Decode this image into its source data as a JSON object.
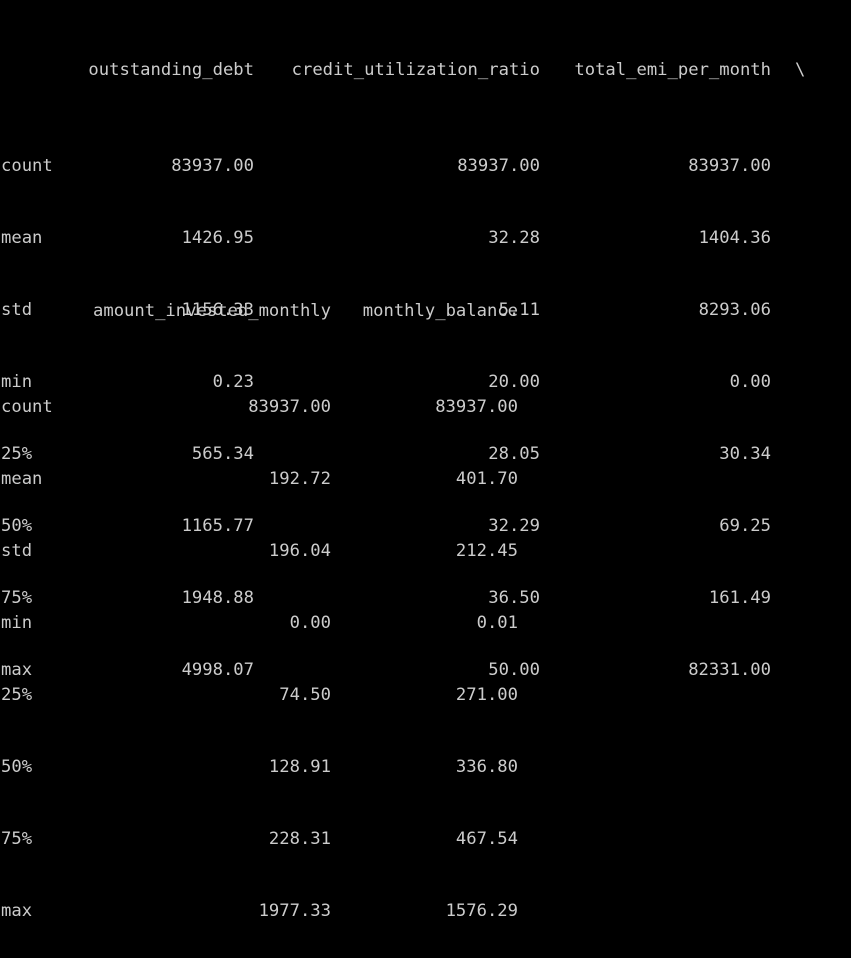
{
  "table1": {
    "columns": [
      "outstanding_debt",
      "credit_utilization_ratio",
      "total_emi_per_month"
    ],
    "continuation": "\\",
    "rows": [
      {
        "label": "count",
        "values": [
          "83937.00",
          "83937.00",
          "83937.00"
        ]
      },
      {
        "label": "mean",
        "values": [
          "1426.95",
          "32.28",
          "1404.36"
        ]
      },
      {
        "label": "std",
        "values": [
          "1156.33",
          "5.11",
          "8293.06"
        ]
      },
      {
        "label": "min",
        "values": [
          "0.23",
          "20.00",
          "0.00"
        ]
      },
      {
        "label": "25%",
        "values": [
          "565.34",
          "28.05",
          "30.34"
        ]
      },
      {
        "label": "50%",
        "values": [
          "1165.77",
          "32.29",
          "69.25"
        ]
      },
      {
        "label": "75%",
        "values": [
          "1948.88",
          "36.50",
          "161.49"
        ]
      },
      {
        "label": "max",
        "values": [
          "4998.07",
          "50.00",
          "82331.00"
        ]
      }
    ]
  },
  "table2": {
    "columns": [
      "amount_invested_monthly",
      "monthly_balance"
    ],
    "rows": [
      {
        "label": "count",
        "values": [
          "83937.00",
          "83937.00"
        ]
      },
      {
        "label": "mean",
        "values": [
          "192.72",
          "401.70"
        ]
      },
      {
        "label": "std",
        "values": [
          "196.04",
          "212.45"
        ]
      },
      {
        "label": "min",
        "values": [
          "0.00",
          "0.01"
        ]
      },
      {
        "label": "25%",
        "values": [
          "74.50",
          "271.00"
        ]
      },
      {
        "label": "50%",
        "values": [
          "128.91",
          "336.80"
        ]
      },
      {
        "label": "75%",
        "values": [
          "228.31",
          "467.54"
        ]
      },
      {
        "label": "max",
        "values": [
          "1977.33",
          "1576.29"
        ]
      }
    ]
  }
}
